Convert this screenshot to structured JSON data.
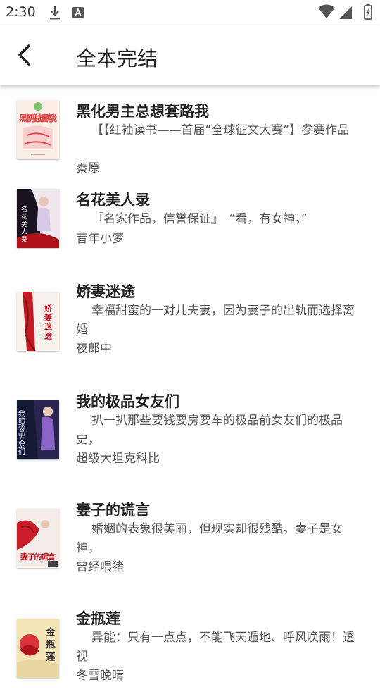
{
  "status": {
    "time": "2:30"
  },
  "appbar": {
    "title": "全本完结"
  },
  "books": [
    {
      "title": "黑化男主总想套路我",
      "desc": "【【红袖读书——首届“全球征文大赛”】参赛作品",
      "author": "秦原"
    },
    {
      "title": "名花美人录",
      "desc": "『名家作品，信誉保证』　“看，有女神。”",
      "author": "昔年小梦"
    },
    {
      "title": "娇妻迷途",
      "desc": "幸福甜蜜的一对儿夫妻，因为妻子的出轨而选择离婚",
      "author": "夜郎中"
    },
    {
      "title": "我的极品女友们",
      "desc": "扒一扒那些要钱要房要车的极品前女友们的极品史，",
      "author": "超级大坦克科比"
    },
    {
      "title": "妻子的谎言",
      "desc": "婚姻的表象很美丽，但现实却很残酷。妻子是女神，",
      "author": "曾经喂猪"
    },
    {
      "title": "金瓶莲",
      "desc": "异能：只有一点点，不能飞天遁地、呼风唤雨！透视",
      "author": "冬雪晚晴"
    }
  ],
  "covers": [
    {
      "text": "黑化男主 总想 套路我"
    },
    {
      "text": "名花美人录"
    },
    {
      "text": "娇妻迷途"
    },
    {
      "text": "我的极品女友们"
    },
    {
      "text": "妻子的谎言"
    },
    {
      "text": "金瓶莲"
    }
  ]
}
